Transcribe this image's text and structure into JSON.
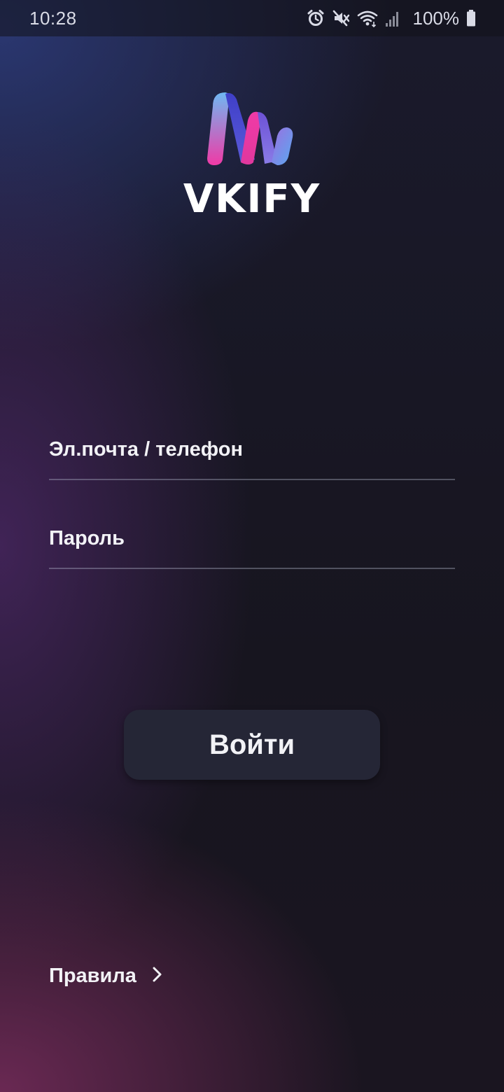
{
  "status_bar": {
    "time": "10:28",
    "icons": [
      "alarm-icon",
      "mute-icon",
      "wifi-icon",
      "signal-icon",
      "battery-icon"
    ],
    "battery": "100%"
  },
  "app": {
    "logo_icon": "vkify-logo-icon",
    "brand": "VKIFY",
    "colors": {
      "logo_pink": "#f23aa8",
      "logo_blue": "#5aa8f0",
      "logo_purple": "#6a4cd8",
      "button_bg": "#252636"
    }
  },
  "login_form": {
    "email_label": "Эл.почта / телефон",
    "password_label": "Пароль",
    "login_button": "Войти"
  },
  "footer": {
    "rules_label": "Правила",
    "rules_icon": "chevron-right-icon"
  }
}
